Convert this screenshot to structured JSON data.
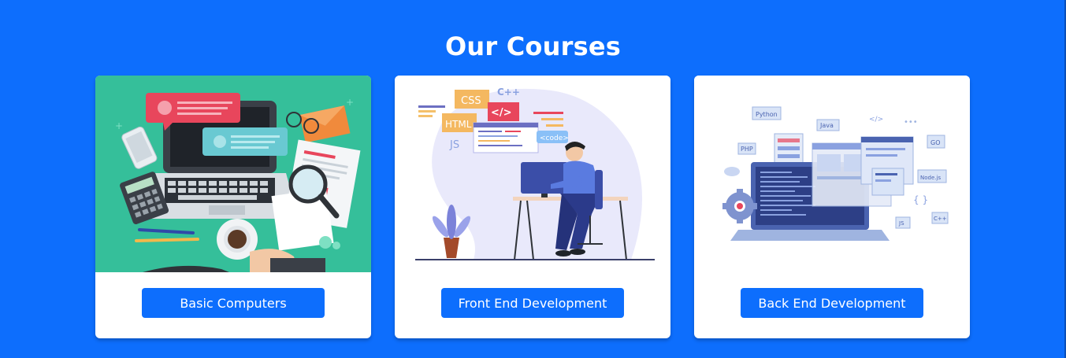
{
  "section": {
    "title": "Our Courses"
  },
  "courses": [
    {
      "label": "Basic Computers",
      "illustration": "laptop-desk-icon"
    },
    {
      "label": "Front End Development",
      "illustration": "developer-at-desk-icon",
      "tags": [
        "CSS",
        "C++",
        "HTML",
        "JS",
        "</>",
        "<code>"
      ]
    },
    {
      "label": "Back End Development",
      "illustration": "backend-laptop-icon",
      "tags": [
        "Python",
        "Java",
        "PHP",
        "Node.js",
        "GO",
        "JS",
        "C++",
        "</>",
        "{ }"
      ]
    }
  ],
  "colors": {
    "background": "#0d6efd",
    "card": "#ffffff",
    "button": "#0d6efd",
    "card1_image_bg": "#35bf9a"
  }
}
